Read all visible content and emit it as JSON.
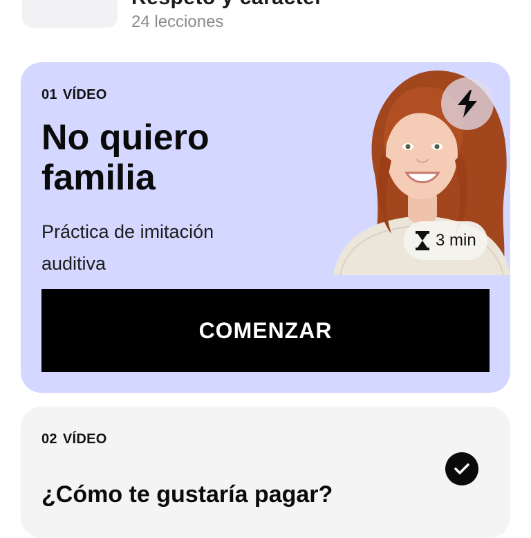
{
  "course": {
    "title": "Respeto y carácter",
    "lessons_count": "24 lecciones"
  },
  "lessons": [
    {
      "number": "01",
      "type": "VÍDEO",
      "title": "No quiero familia",
      "subtitle": "Práctica de imitación auditiva",
      "duration": "3 min",
      "badge_icon": "lightning-bolt-icon",
      "duration_icon": "hourglass-icon",
      "cta_label": "COMENZAR",
      "state": "active"
    },
    {
      "number": "02",
      "type": "VÍDEO",
      "title": "¿Cómo te gustaría pagar?",
      "state_icon": "checkmark-icon",
      "state": "completed"
    }
  ],
  "colors": {
    "active_card": "#d4d7ff",
    "done_card": "#f4f4f4",
    "primary_button": "#000000",
    "muted_text": "#8a8a8a"
  }
}
